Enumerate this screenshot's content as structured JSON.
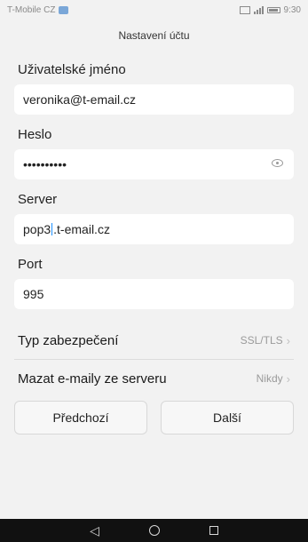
{
  "status_bar": {
    "carrier": "T-Mobile CZ",
    "time": "9:30",
    "left_icon": "notification-icon",
    "right_icons": [
      "gallery-icon",
      "signal-icon",
      "battery-icon"
    ]
  },
  "header": {
    "title": "Nastavení účtu"
  },
  "fields": {
    "username": {
      "label": "Uživatelské jméno",
      "value": "veronika@t-email.cz"
    },
    "password": {
      "label": "Heslo",
      "value": "••••••••••",
      "icon": "eye-icon"
    },
    "server": {
      "label": "Server",
      "value_before_cursor": "pop3",
      "value_after_cursor": ".t-email.cz"
    },
    "port": {
      "label": "Port",
      "value": "995"
    }
  },
  "settings": {
    "security_type": {
      "label": "Typ zabezpečení",
      "value": "SSL/TLS",
      "icon": "chevron-right-icon"
    },
    "delete_emails": {
      "label": "Mazat e-maily ze serveru",
      "value": "Nikdy",
      "icon": "chevron-right-icon"
    }
  },
  "buttons": {
    "previous": "Předchozí",
    "next": "Další"
  },
  "navigation": {
    "back_icon": "back-icon",
    "home_icon": "home-icon",
    "recents_icon": "recents-icon"
  },
  "colors": {
    "background": "#f2f2f2",
    "input_background": "#ffffff",
    "cursor": "#1e90ff",
    "nav_bar": "#111111"
  }
}
